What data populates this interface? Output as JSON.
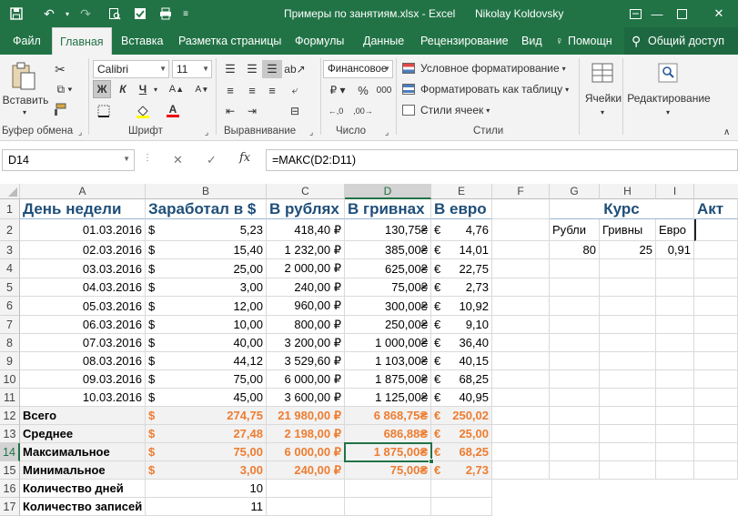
{
  "window": {
    "title": "Примеры по занятиям.xlsx - Excel",
    "user": "Nikolay Koldovsky"
  },
  "tabs": [
    "Файл",
    "Главная",
    "Вставка",
    "Разметка страницы",
    "Формулы",
    "Данные",
    "Рецензирование",
    "Вид",
    "Помощн",
    "Общий доступ"
  ],
  "ribbon": {
    "paste_label": "Вставить",
    "clipboard_label": "Буфер обмена",
    "font_name": "Calibri",
    "font_size": "11",
    "font_label": "Шрифт",
    "bold": "Ж",
    "italic": "К",
    "underline": "Ч",
    "align_label": "Выравнивание",
    "number_format": "Финансовое",
    "number_label": "Число",
    "percent": "%",
    "thousands": "000",
    "cond_format": "Условное форматирование",
    "format_table": "Форматировать как таблицу",
    "cell_styles": "Стили ячеек",
    "styles_label": "Стили",
    "cells_label": "Ячейки",
    "editing_label": "Редактирование",
    "accent": "#217346"
  },
  "formula_bar": {
    "name_box": "D14",
    "formula": "=МАКС(D2:D11)"
  },
  "columns": [
    "A",
    "B",
    "C",
    "D",
    "E",
    "F",
    "G",
    "H",
    "I"
  ],
  "rows": [
    "1",
    "2",
    "3",
    "4",
    "5",
    "6",
    "7",
    "8",
    "9",
    "10",
    "11",
    "12",
    "13",
    "14",
    "15",
    "16",
    "17"
  ],
  "cells": {
    "r1": {
      "a": "День недели",
      "b": "Заработал в $",
      "c": "В рублях",
      "d": "В гривнах",
      "e": "В евро",
      "gh": "Курс",
      "j": "Акт"
    },
    "r2": {
      "a": "01.03.2016",
      "bc": "$",
      "b": "5,23",
      "c": "418,40 ₽",
      "d": "130,75₴",
      "ec": "€",
      "e": "4,76",
      "g": "Рубли",
      "h": "Гривны",
      "i": "Евро"
    },
    "r3": {
      "a": "02.03.2016",
      "bc": "$",
      "b": "15,40",
      "c": "1 232,00 ₽",
      "d": "385,00₴",
      "ec": "€",
      "e": "14,01",
      "g": "80",
      "h": "25",
      "i": "0,91"
    },
    "r4": {
      "a": "03.03.2016",
      "bc": "$",
      "b": "25,00",
      "c": "2 000,00 ₽",
      "d": "625,00₴",
      "ec": "€",
      "e": "22,75"
    },
    "r5": {
      "a": "04.03.2016",
      "bc": "$",
      "b": "3,00",
      "c": "240,00 ₽",
      "d": "75,00₴",
      "ec": "€",
      "e": "2,73"
    },
    "r6": {
      "a": "05.03.2016",
      "bc": "$",
      "b": "12,00",
      "c": "960,00 ₽",
      "d": "300,00₴",
      "ec": "€",
      "e": "10,92"
    },
    "r7": {
      "a": "06.03.2016",
      "bc": "$",
      "b": "10,00",
      "c": "800,00 ₽",
      "d": "250,00₴",
      "ec": "€",
      "e": "9,10"
    },
    "r8": {
      "a": "07.03.2016",
      "bc": "$",
      "b": "40,00",
      "c": "3 200,00 ₽",
      "d": "1 000,00₴",
      "ec": "€",
      "e": "36,40"
    },
    "r9": {
      "a": "08.03.2016",
      "bc": "$",
      "b": "44,12",
      "c": "3 529,60 ₽",
      "d": "1 103,00₴",
      "ec": "€",
      "e": "40,15"
    },
    "r10": {
      "a": "09.03.2016",
      "bc": "$",
      "b": "75,00",
      "c": "6 000,00 ₽",
      "d": "1 875,00₴",
      "ec": "€",
      "e": "68,25"
    },
    "r11": {
      "a": "10.03.2016",
      "bc": "$",
      "b": "45,00",
      "c": "3 600,00 ₽",
      "d": "1 125,00₴",
      "ec": "€",
      "e": "40,95"
    },
    "r12": {
      "a": "Всего",
      "bc": "$",
      "b": "274,75",
      "c": "21 980,00 ₽",
      "d": "6 868,75₴",
      "ec": "€",
      "e": "250,02"
    },
    "r13": {
      "a": "Среднее",
      "bc": "$",
      "b": "27,48",
      "c": "2 198,00 ₽",
      "d": "686,88₴",
      "ec": "€",
      "e": "25,00"
    },
    "r14": {
      "a": "Максимальное",
      "bc": "$",
      "b": "75,00",
      "c": "6 000,00 ₽",
      "d": "1 875,00₴",
      "ec": "€",
      "e": "68,25"
    },
    "r15": {
      "a": "Минимальное",
      "bc": "$",
      "b": "3,00",
      "c": "240,00 ₽",
      "d": "75,00₴",
      "ec": "€",
      "e": "2,73"
    },
    "r16": {
      "a": "Количество дней",
      "b": "10"
    },
    "r17": {
      "a": "Количество записей",
      "b": "11"
    }
  }
}
